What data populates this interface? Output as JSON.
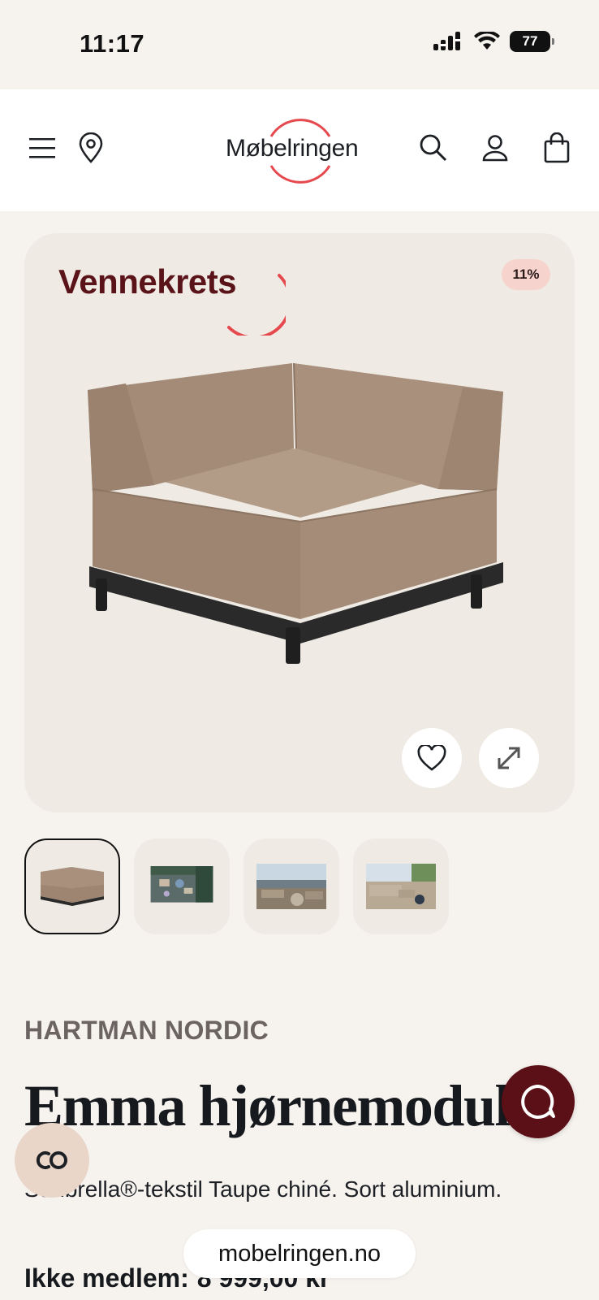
{
  "status_bar": {
    "time": "11:17",
    "battery": "77"
  },
  "header": {
    "logo_text": "Møbelringen",
    "icons": [
      "menu-icon",
      "location-pin-icon",
      "search-icon",
      "user-icon",
      "shopping-bag-icon"
    ],
    "accent_color": "#e5484d"
  },
  "hero": {
    "badge_logo_text": "Vennekrets",
    "discount": "11%",
    "favorite_icon": "heart-icon",
    "expand_icon": "expand-icon"
  },
  "thumbnails": [
    {
      "name": "corner-module",
      "active": true
    },
    {
      "name": "aerial-patio",
      "active": false
    },
    {
      "name": "terrace-view",
      "active": false
    },
    {
      "name": "sofa-terrace",
      "active": false
    }
  ],
  "product": {
    "brand": "HARTMAN NORDIC",
    "title": "Emma hjørnemodul",
    "subtitle": "Sunbrella®-tekstil Taupe chiné. Sort aluminium.",
    "price_label": "Ikke medlem:",
    "price_value": "8 999,00 kr"
  },
  "browser": {
    "url": "mobelringen.no"
  },
  "colors": {
    "brand_red": "#e5484d",
    "vennekrets": "#5a1419",
    "chat": "#5a1016"
  }
}
